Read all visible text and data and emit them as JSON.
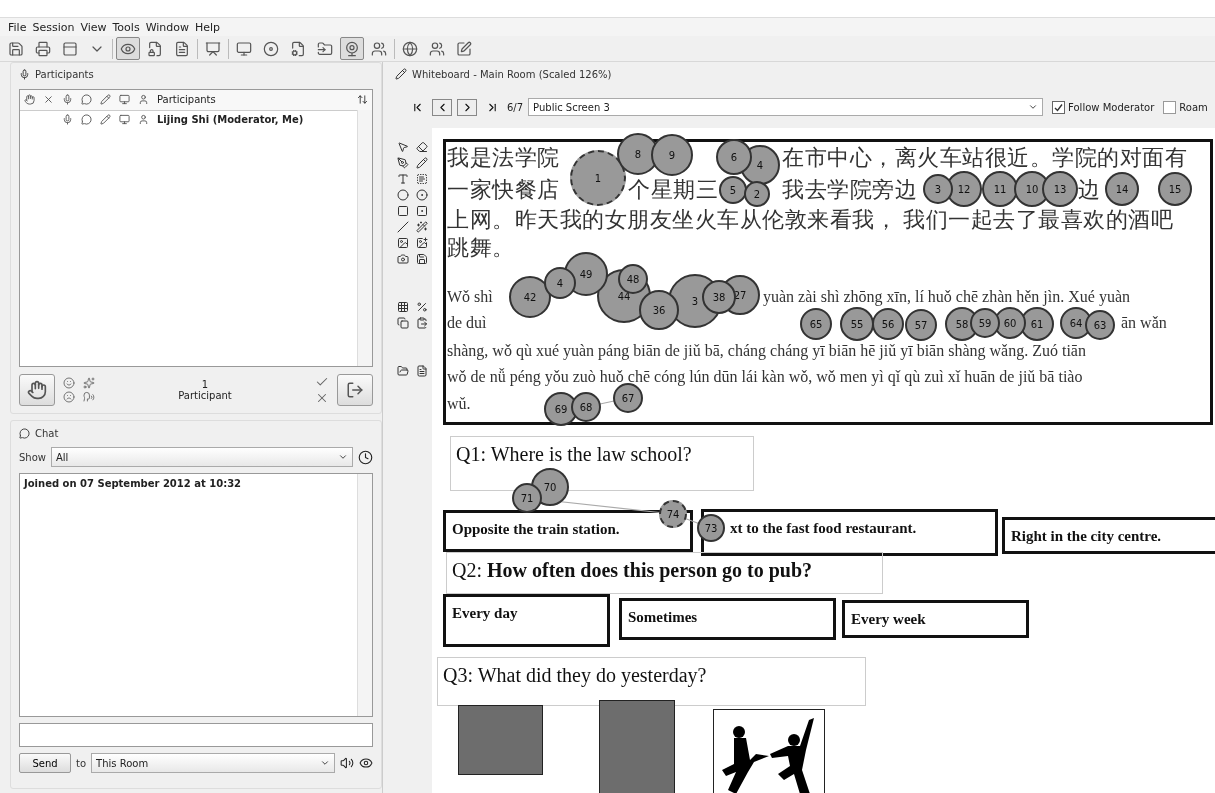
{
  "menu": [
    "File",
    "Session",
    "View",
    "Tools",
    "Window",
    "Help"
  ],
  "participants": {
    "title": "Participants",
    "column_header": "Participants",
    "rows": [
      {
        "name": "Lijing Shi (Moderator, Me)"
      }
    ],
    "count": "1",
    "count_label": "Participant"
  },
  "chat": {
    "title": "Chat",
    "show_label": "Show",
    "show_value": "All",
    "messages": [
      "Joined on 07 September 2012 at 10:32"
    ],
    "send_button": "Send",
    "to_label": "to",
    "to_value": "This Room"
  },
  "whiteboard": {
    "title": "Whiteboard - Main Room (Scaled 126%)",
    "page": "6/7",
    "screen": "Public Screen 3",
    "follow_moderator": {
      "label": "Follow Moderator",
      "checked": true
    },
    "roam": {
      "label": "Roam",
      "checked": false
    },
    "passage": {
      "chinese_lines": [
        [
          "我是法学院",
          "在市中心，离火车站很近。学院的对面有"
        ],
        [
          "一家快餐店",
          "个星期三",
          "我去学院旁边",
          "边"
        ],
        [
          "上网。昨天我的女朋友坐火车从伦敦来看我， 我们一起去了最喜欢的酒吧"
        ],
        [
          "跳舞。"
        ]
      ],
      "pinyin_lines": [
        [
          "Wǒ shì",
          "yuàn zài shì zhōng xīn, lí huǒ chē zhàn hěn jìn. Xué yuàn"
        ],
        [
          "de duì",
          "ān wǎn"
        ],
        [
          "shàng, wǒ qù xué yuàn páng biān de jiǔ bā,  cháng cháng yī biān hē jiǔ yī biān shàng wǎng.  Zuó tiān"
        ],
        [
          "wǒ de nǚ péng yǒu zuò huǒ chē cóng lún dūn lái kàn wǒ, wǒ men yì qǐ qù zuì xǐ huān de jiǔ bā tiào"
        ],
        [
          "wǔ."
        ]
      ]
    },
    "questions": [
      {
        "text": "Q1: Where is the law school?",
        "answers": [
          "Opposite the train station.",
          "xt to the fast food restaurant.",
          "Right in the city centre."
        ]
      },
      {
        "text": "Q2: **How often does this person go to pub?**",
        "answers": [
          "Every day",
          "Sometimes",
          "Every week"
        ]
      },
      {
        "text": "Q3: What did they do yesterday?",
        "pictures": [
          {
            "kind": "photo"
          },
          {
            "kind": "photo"
          },
          {
            "kind": "silhouette"
          }
        ]
      }
    ],
    "fixations": [
      {
        "label": "1",
        "kind": "start"
      },
      {
        "label": "8",
        "kind": "fixation"
      },
      {
        "label": "9",
        "kind": "fixation"
      },
      {
        "label": "6",
        "kind": "fixation"
      },
      {
        "label": "5",
        "kind": "fixation"
      },
      {
        "label": "2",
        "kind": "fixation"
      },
      {
        "label": "4",
        "kind": "fixation"
      },
      {
        "label": "3",
        "kind": "fixation"
      },
      {
        "label": "12",
        "kind": "fixation"
      },
      {
        "label": "11",
        "kind": "fixation"
      },
      {
        "label": "10",
        "kind": "fixation"
      },
      {
        "label": "13",
        "kind": "fixation"
      },
      {
        "label": "14",
        "kind": "fixation"
      },
      {
        "label": "15",
        "kind": "fixation"
      },
      {
        "label": "42",
        "kind": "fixation"
      },
      {
        "label": "4",
        "kind": "fixation"
      },
      {
        "label": "49",
        "kind": "fixation"
      },
      {
        "label": "44",
        "kind": "fixation"
      },
      {
        "label": "48",
        "kind": "fixation"
      },
      {
        "label": "36",
        "kind": "fixation"
      },
      {
        "label": "3",
        "kind": "fixation"
      },
      {
        "label": "38",
        "kind": "fixation"
      },
      {
        "label": "27",
        "kind": "fixation"
      },
      {
        "label": "65",
        "kind": "fixation"
      },
      {
        "label": "55",
        "kind": "fixation"
      },
      {
        "label": "56",
        "kind": "fixation"
      },
      {
        "label": "57",
        "kind": "fixation"
      },
      {
        "label": "58",
        "kind": "fixation"
      },
      {
        "label": "59",
        "kind": "fixation"
      },
      {
        "label": "60",
        "kind": "fixation"
      },
      {
        "label": "61",
        "kind": "fixation"
      },
      {
        "label": "64",
        "kind": "fixation"
      },
      {
        "label": "63",
        "kind": "fixation"
      },
      {
        "label": "69",
        "kind": "fixation"
      },
      {
        "label": "68",
        "kind": "fixation"
      },
      {
        "label": "67",
        "kind": "fixation"
      },
      {
        "label": "71",
        "kind": "fixation"
      },
      {
        "label": "70",
        "kind": "fixation"
      },
      {
        "label": "74",
        "kind": "end"
      },
      {
        "label": "73",
        "kind": "fixation"
      }
    ]
  }
}
